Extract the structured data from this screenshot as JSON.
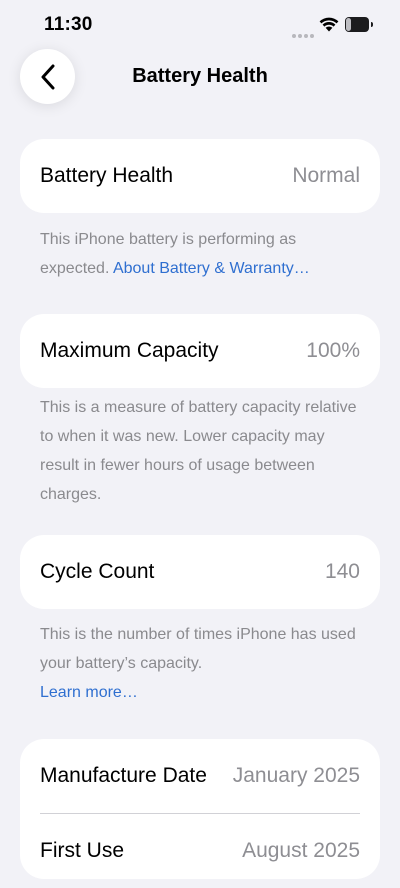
{
  "status_bar": {
    "time": "11:30",
    "battery_level": "22",
    "battery_fraction": 0.22
  },
  "nav": {
    "title": "Battery Health",
    "back_icon": "chevron-left-icon"
  },
  "sections": {
    "health": {
      "label": "Battery Health",
      "value": "Normal",
      "footnote": "This iPhone battery is performing as expected.",
      "link": "About Battery & Warranty…"
    },
    "capacity": {
      "label": "Maximum Capacity",
      "value": "100%",
      "footnote": "This is a measure of battery capacity relative to when it was new. Lower capacity may result in fewer hours of usage between charges."
    },
    "cycles": {
      "label": "Cycle Count",
      "value": "140",
      "footnote": "This is the number of times iPhone has used your battery’s capacity.",
      "link": "Learn more…"
    },
    "dates": {
      "manufacture_label": "Manufacture Date",
      "manufacture_value": "January 2025",
      "first_use_label": "First Use",
      "first_use_value": "August 2025"
    }
  },
  "colors": {
    "background": "#f2f2f7",
    "card": "#ffffff",
    "secondary_text": "#8e8e93",
    "link": "#2f6fd0"
  }
}
